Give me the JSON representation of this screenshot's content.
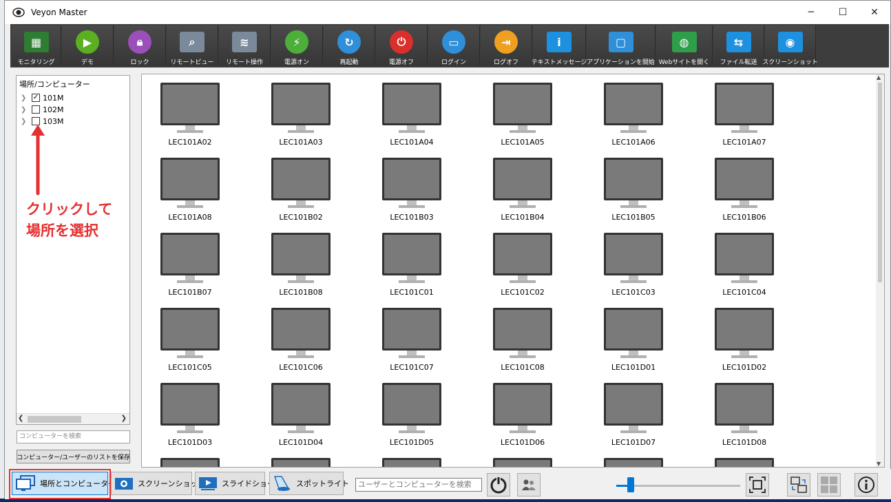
{
  "window": {
    "title": "Veyon Master",
    "minimize": "─",
    "maximize": "☐",
    "close": "✕"
  },
  "toolbar": [
    {
      "label": "モニタリング",
      "icon": "monitoring-icon",
      "color": "#2e7d32"
    },
    {
      "label": "デモ",
      "icon": "demo-icon",
      "color": "#5bb021"
    },
    {
      "label": "ロック",
      "icon": "lock-icon",
      "color": "#9b4fb8"
    },
    {
      "label": "リモートビュー",
      "icon": "remote-view-icon",
      "color": "#7b8a9a"
    },
    {
      "label": "リモート操作",
      "icon": "remote-control-icon",
      "color": "#7b8a9a"
    },
    {
      "label": "電源オン",
      "icon": "power-on-icon",
      "color": "#4caf3a"
    },
    {
      "label": "再起動",
      "icon": "reboot-icon",
      "color": "#2f8fd8"
    },
    {
      "label": "電源オフ",
      "icon": "power-off-icon",
      "color": "#d9302c"
    },
    {
      "label": "ログイン",
      "icon": "login-icon",
      "color": "#2f8fd8"
    },
    {
      "label": "ログオフ",
      "icon": "logoff-icon",
      "color": "#f0a020"
    },
    {
      "label": "テキストメッセージ",
      "icon": "text-message-icon",
      "color": "#1e90e0"
    },
    {
      "label": "アプリケーションを開始",
      "icon": "start-app-icon",
      "color": "#2f8fd8"
    },
    {
      "label": "Webサイトを開く",
      "icon": "website-icon",
      "color": "#2f9e4a"
    },
    {
      "label": "ファイル転送",
      "icon": "file-transfer-icon",
      "color": "#1e90e0"
    },
    {
      "label": "スクリーンショット",
      "icon": "screenshot-icon",
      "color": "#1e90e0"
    }
  ],
  "left_panel": {
    "title": "場所/コンピューター",
    "locations": [
      {
        "label": "101M",
        "checked": "✓"
      },
      {
        "label": "102M",
        "checked": ""
      },
      {
        "label": "103M",
        "checked": ""
      }
    ],
    "search_placeholder": "コンピューターを検索",
    "save_list_label": "コンピューター/ユーザーのリストを保存"
  },
  "annotation": {
    "line1": "クリックして",
    "line2": "場所を選択",
    "color": "#e53030"
  },
  "computers": [
    "LEC101A02",
    "LEC101A03",
    "LEC101A04",
    "LEC101A05",
    "LEC101A06",
    "LEC101A07",
    "LEC101A08",
    "LEC101B02",
    "LEC101B03",
    "LEC101B04",
    "LEC101B05",
    "LEC101B06",
    "LEC101B07",
    "LEC101B08",
    "LEC101C01",
    "LEC101C02",
    "LEC101C03",
    "LEC101C04",
    "LEC101C05",
    "LEC101C06",
    "LEC101C07",
    "LEC101C08",
    "LEC101D01",
    "LEC101D02",
    "LEC101D03",
    "LEC101D04",
    "LEC101D05",
    "LEC101D06",
    "LEC101D07",
    "LEC101D08",
    "",
    "",
    "",
    "",
    "",
    ""
  ],
  "bottom_bar": {
    "locations_button": "場所とコンピューター",
    "screenshot_button": "スクリーンショット",
    "slideshow_button": "スライドショー",
    "spotlight_button": "スポットライト",
    "search_placeholder": "ユーザーとコンピューターを検索",
    "zoom_level": 0.09
  }
}
